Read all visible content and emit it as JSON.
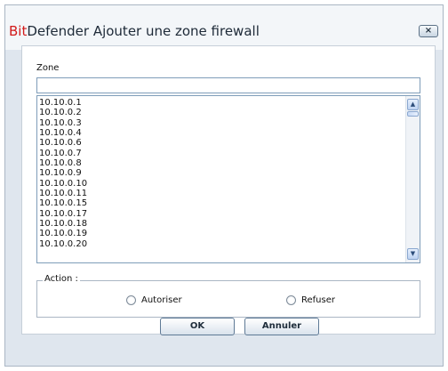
{
  "window": {
    "title_brand": "Bit",
    "title_rest": "Defender Ajouter une zone firewall",
    "close_label": "×"
  },
  "zone": {
    "label": "Zone",
    "value": ""
  },
  "list": {
    "items": [
      "10.10.0.1",
      "10.10.0.2",
      "10.10.0.3",
      "10.10.0.4",
      "10.10.0.6",
      "10.10.0.7",
      "10.10.0.8",
      "10.10.0.9",
      "10.10.0.10",
      "10.10.0.11",
      "10.10.0.15",
      "10.10.0.17",
      "10.10.0.18",
      "10.10.0.19",
      "10.10.0.20"
    ],
    "scroll_up_icon": "▲",
    "scroll_down_icon": "▼"
  },
  "action": {
    "legend": "Action :",
    "allow_label": "Autoriser",
    "deny_label": "Refuser",
    "selected": null
  },
  "buttons": {
    "ok_label": "OK",
    "cancel_label": "Annuler"
  },
  "colors": {
    "brand_red": "#d21a1a",
    "dialog_bg": "#dfe6ee"
  }
}
